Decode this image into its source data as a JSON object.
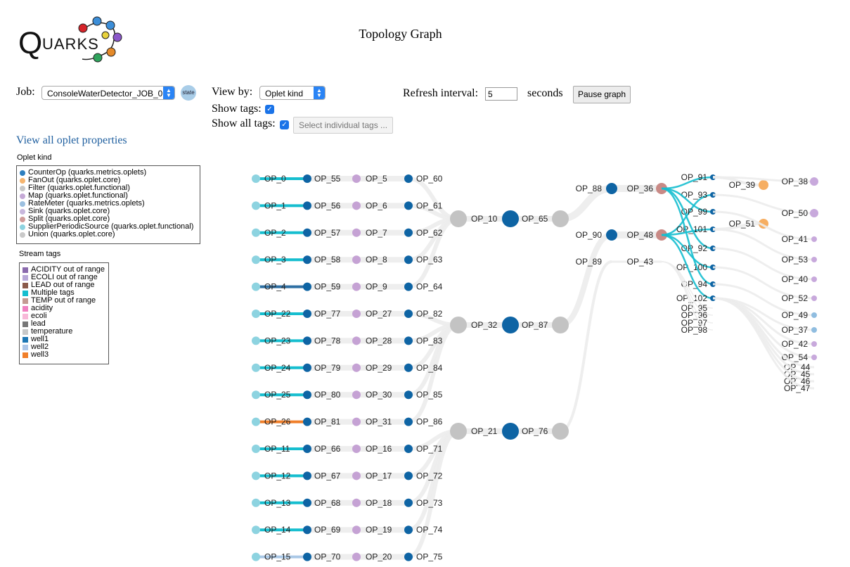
{
  "logo": {
    "text": "QUARKS",
    "colors": [
      "#d6242a",
      "#3c8ed8",
      "#8a57c9",
      "#e58a2a",
      "#2fa35c",
      "#5a6fd6",
      "#e8d23b"
    ]
  },
  "header": {
    "title": "Topology Graph"
  },
  "controls": {
    "job_label": "Job:",
    "job_value": "ConsoleWaterDetector_JOB_0",
    "state_label": "state",
    "view_by_label": "View by:",
    "view_by_value": "Oplet kind",
    "show_tags_label": "Show tags:",
    "show_tags_checked": true,
    "show_all_tags_label": "Show all tags:",
    "show_all_tags_checked": true,
    "select_tags_button": "Select individual tags ...",
    "refresh_label": "Refresh interval:",
    "refresh_value": "5",
    "seconds_label": "seconds",
    "pause_button": "Pause graph"
  },
  "view_all_link": "View all oplet properties",
  "oplet_legend": {
    "title": "Oplet kind",
    "items": [
      {
        "label": "CounterOp (quarks.metrics.oplets)",
        "color": "#2e7fbf"
      },
      {
        "label": "FanOut (quarks.oplet.core)",
        "color": "#f6b56f"
      },
      {
        "label": "Filter (quarks.oplet.functional)",
        "color": "#c7c7c7"
      },
      {
        "label": "Map (quarks.oplet.functional)",
        "color": "#c5a9d6"
      },
      {
        "label": "RateMeter (quarks.metrics.oplets)",
        "color": "#9cc0e0"
      },
      {
        "label": "Sink (quarks.oplet.core)",
        "color": "#c8b7dc"
      },
      {
        "label": "Split (quarks.oplet.core)",
        "color": "#d09c9a"
      },
      {
        "label": "SupplierPeriodicSource (quarks.oplet.functional)",
        "color": "#8dd3e0"
      },
      {
        "label": "Union (quarks.oplet.core)",
        "color": "#c9c9c9"
      }
    ]
  },
  "stream_legend": {
    "title": "Stream tags",
    "items": [
      {
        "label": "ACIDITY out of range",
        "color": "#8a6aad"
      },
      {
        "label": "ECOLI out of range",
        "color": "#b8a8d8"
      },
      {
        "label": "LEAD out of range",
        "color": "#8b5a4a"
      },
      {
        "label": "Multiple tags",
        "color": "#16becf"
      },
      {
        "label": "TEMP out of range",
        "color": "#c49a92"
      },
      {
        "label": "acidity",
        "color": "#f080c0"
      },
      {
        "label": "ecoli",
        "color": "#f8b8d8"
      },
      {
        "label": "lead",
        "color": "#777777"
      },
      {
        "label": "temperature",
        "color": "#c8c8c8"
      },
      {
        "label": "well1",
        "color": "#1f77b4"
      },
      {
        "label": "well2",
        "color": "#aec7e8"
      },
      {
        "label": "well3",
        "color": "#f07f2a"
      }
    ]
  },
  "graph": {
    "chains": [
      {
        "src": "OP_0",
        "cnt": "OP_55",
        "map": "OP_5",
        "ctr": "OP_60",
        "tag": "multiple"
      },
      {
        "src": "OP_1",
        "cnt": "OP_56",
        "map": "OP_6",
        "ctr": "OP_61",
        "tag": "multiple"
      },
      {
        "src": "OP_2",
        "cnt": "OP_57",
        "map": "OP_7",
        "ctr": "OP_62",
        "tag": "multiple"
      },
      {
        "src": "OP_3",
        "cnt": "OP_58",
        "map": "OP_8",
        "ctr": "OP_63",
        "tag": "multiple"
      },
      {
        "src": "OP_4",
        "cnt": "OP_59",
        "map": "OP_9",
        "ctr": "OP_64",
        "tag": "well1"
      },
      {
        "src": "OP_22",
        "cnt": "OP_77",
        "map": "OP_27",
        "ctr": "OP_82",
        "tag": "multiple"
      },
      {
        "src": "OP_23",
        "cnt": "OP_78",
        "map": "OP_28",
        "ctr": "OP_83",
        "tag": "multiple"
      },
      {
        "src": "OP_24",
        "cnt": "OP_79",
        "map": "OP_29",
        "ctr": "OP_84",
        "tag": "multiple"
      },
      {
        "src": "OP_25",
        "cnt": "OP_80",
        "map": "OP_30",
        "ctr": "OP_85",
        "tag": "multiple"
      },
      {
        "src": "OP_26",
        "cnt": "OP_81",
        "map": "OP_31",
        "ctr": "OP_86",
        "tag": "well3"
      },
      {
        "src": "OP_11",
        "cnt": "OP_66",
        "map": "OP_16",
        "ctr": "OP_71",
        "tag": "multiple"
      },
      {
        "src": "OP_12",
        "cnt": "OP_67",
        "map": "OP_17",
        "ctr": "OP_72",
        "tag": "multiple"
      },
      {
        "src": "OP_13",
        "cnt": "OP_68",
        "map": "OP_18",
        "ctr": "OP_73",
        "tag": "multiple"
      },
      {
        "src": "OP_14",
        "cnt": "OP_69",
        "map": "OP_19",
        "ctr": "OP_74",
        "tag": "multiple"
      },
      {
        "src": "OP_15",
        "cnt": "OP_70",
        "map": "OP_20",
        "ctr": "OP_75",
        "tag": "well2"
      }
    ],
    "unions": [
      {
        "union": "OP_10",
        "counter": "OP_65",
        "filter": "OP_65"
      },
      {
        "union": "OP_32",
        "counter": "OP_87",
        "filter": "OP_87"
      },
      {
        "union": "OP_21",
        "counter": "OP_76",
        "filter": "OP_76"
      }
    ],
    "mid": [
      {
        "id": "OP_88",
        "kind": "counter"
      },
      {
        "id": "OP_90",
        "kind": "counter"
      },
      {
        "id": "OP_89",
        "kind": "plain"
      }
    ],
    "splits": [
      {
        "id": "OP_36"
      },
      {
        "id": "OP_48"
      },
      {
        "id": "OP_43",
        "kind": "plain"
      }
    ],
    "split_outputs": [
      {
        "id": "OP_91",
        "kind": "counter"
      },
      {
        "id": "OP_93",
        "kind": "counter"
      },
      {
        "id": "OP_99",
        "kind": "counter"
      },
      {
        "id": "OP_101",
        "kind": "counter"
      },
      {
        "id": "OP_92",
        "kind": "counter"
      },
      {
        "id": "OP_100",
        "kind": "counter"
      },
      {
        "id": "OP_94",
        "kind": "counter"
      },
      {
        "id": "OP_102",
        "kind": "counter"
      },
      {
        "id": "OP_95",
        "kind": "plain"
      },
      {
        "id": "OP_96",
        "kind": "plain"
      },
      {
        "id": "OP_97",
        "kind": "plain"
      },
      {
        "id": "OP_98",
        "kind": "plain"
      }
    ],
    "fanouts": [
      {
        "id": "OP_39"
      },
      {
        "id": "OP_51"
      }
    ],
    "sinks": [
      {
        "id": "OP_38",
        "kind": "sink-lg"
      },
      {
        "id": "OP_50",
        "kind": "sink-lg"
      },
      {
        "id": "OP_41",
        "kind": "sink"
      },
      {
        "id": "OP_53",
        "kind": "sink"
      },
      {
        "id": "OP_40",
        "kind": "sink"
      },
      {
        "id": "OP_52",
        "kind": "sink"
      },
      {
        "id": "OP_49",
        "kind": "rate"
      },
      {
        "id": "OP_37",
        "kind": "rate"
      },
      {
        "id": "OP_42",
        "kind": "sink"
      },
      {
        "id": "OP_54",
        "kind": "sink"
      },
      {
        "id": "OP_44",
        "kind": "plain"
      },
      {
        "id": "OP_45",
        "kind": "plain"
      },
      {
        "id": "OP_46",
        "kind": "plain"
      },
      {
        "id": "OP_47",
        "kind": "plain"
      }
    ]
  }
}
